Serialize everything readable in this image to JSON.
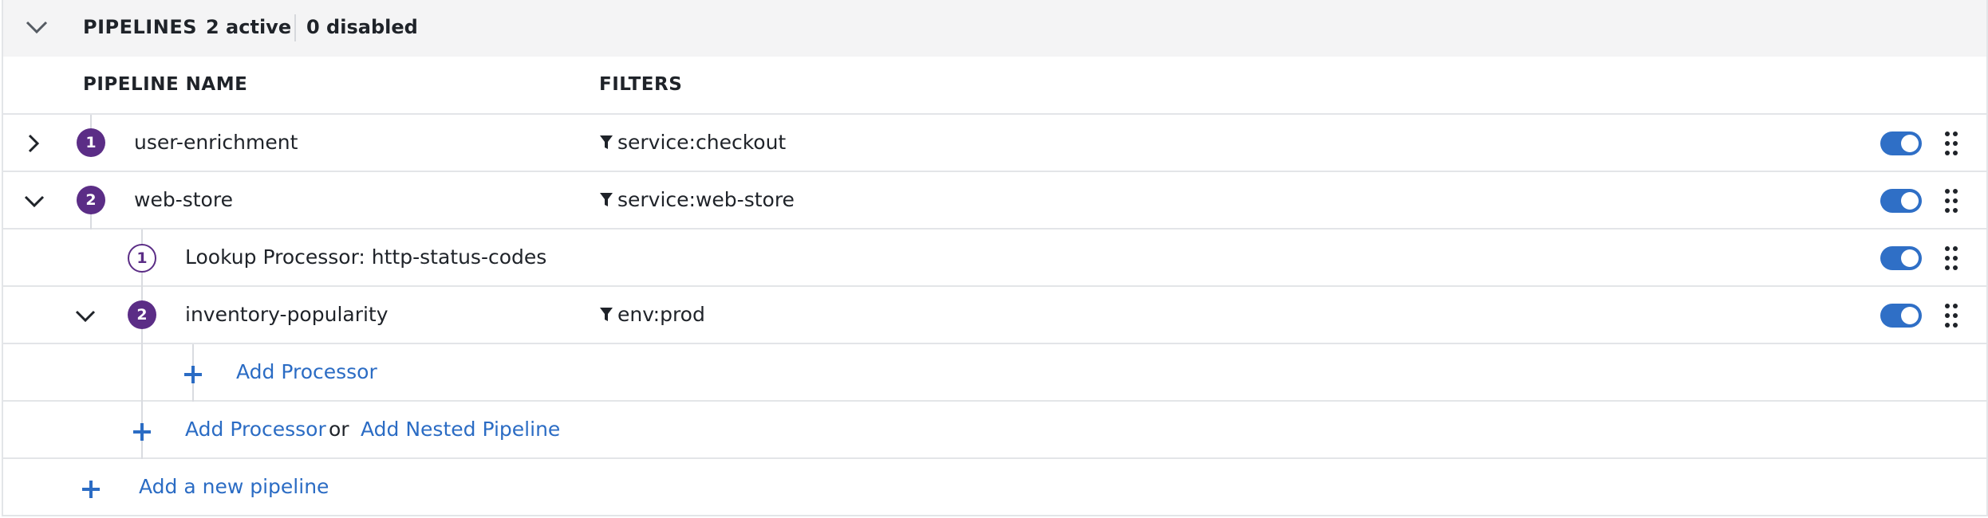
{
  "header": {
    "title": "PIPELINES",
    "active": "2 active",
    "disabled": "0 disabled"
  },
  "columns": {
    "name": "PIPELINE NAME",
    "filters": "FILTERS"
  },
  "rows": [
    {
      "index": "1",
      "name": "user-enrichment",
      "filter": "service:checkout",
      "enabled": true,
      "expanded": false
    },
    {
      "index": "2",
      "name": "web-store",
      "filter": "service:web-store",
      "enabled": true,
      "expanded": true
    },
    {
      "index": "1",
      "name": "Lookup Processor: http-status-codes",
      "filter": "",
      "enabled": true,
      "kind": "processor"
    },
    {
      "index": "2",
      "name": "inventory-popularity",
      "filter": "env:prod",
      "enabled": true,
      "expanded": true,
      "kind": "nested-pipeline"
    }
  ],
  "actions": {
    "add_processor_nested": "Add Processor",
    "add_processor": "Add Processor",
    "or": "or",
    "add_nested_pipeline": "Add Nested Pipeline",
    "add_new_pipeline": "Add a new pipeline"
  },
  "colors": {
    "accent": "#2f6fc6",
    "badge": "#5b2d86",
    "link": "#2b6cc4"
  }
}
